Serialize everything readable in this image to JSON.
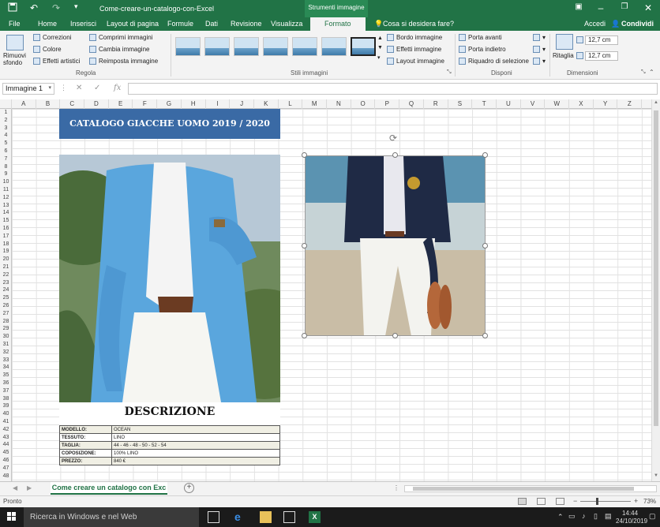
{
  "titlebar": {
    "doc_title": "Come-creare-un-catalogo-con-Excel",
    "context_group": "Strumenti immagine",
    "save_icon": "save-icon",
    "undo_icon": "undo-icon",
    "redo_icon": "redo-icon"
  },
  "tabs": [
    "File",
    "Home",
    "Inserisci",
    "Layout di pagina",
    "Formule",
    "Dati",
    "Revisione",
    "Visualizza",
    "Formato"
  ],
  "active_tab": "Formato",
  "tell_me": "Cosa si desidera fare?",
  "accedi": "Accedi",
  "condividi": "Condividi",
  "ribbon": {
    "rimuovi_sfondo": "Rimuovi sfondo",
    "regola": {
      "label": "Regola",
      "buttons": [
        "Correzioni",
        "Colore",
        "Effetti artistici",
        "Comprimi immagini",
        "Cambia immagine",
        "Reimposta immagine"
      ]
    },
    "stili": {
      "label": "Stili immagini",
      "buttons": [
        "Bordo immagine",
        "Effetti immagine",
        "Layout immagine"
      ]
    },
    "disponi": {
      "label": "Disponi",
      "buttons": [
        "Porta avanti",
        "Porta indietro",
        "Riquadro di selezione"
      ]
    },
    "dimensioni": {
      "label": "Dimensioni",
      "ritaglia": "Ritaglia",
      "height": "12,7 cm",
      "width": "12,7 cm"
    }
  },
  "formula_bar": {
    "name_box": "Immagine 1",
    "fx": "fx",
    "value": ""
  },
  "columns": [
    "A",
    "B",
    "C",
    "D",
    "E",
    "F",
    "G",
    "H",
    "I",
    "J",
    "K",
    "L",
    "M",
    "N",
    "O",
    "P",
    "Q",
    "R",
    "S",
    "T",
    "U",
    "V",
    "W",
    "X",
    "Y",
    "Z"
  ],
  "rows": [
    "1",
    "2",
    "3",
    "4",
    "5",
    "6",
    "7",
    "8",
    "9",
    "10",
    "11",
    "12",
    "13",
    "14",
    "15",
    "16",
    "17",
    "18",
    "19",
    "20",
    "21",
    "22",
    "23",
    "24",
    "25",
    "26",
    "27",
    "28",
    "29",
    "30",
    "31",
    "32",
    "33",
    "34",
    "35",
    "36",
    "37",
    "38",
    "39",
    "40",
    "41",
    "42",
    "43",
    "44",
    "45",
    "46",
    "47",
    "48"
  ],
  "catalog": {
    "header": "CATALOGO GIACCHE UOMO 2019 / 2020",
    "description_title": "DESCRIZIONE",
    "specs": [
      {
        "label": "MODELLO:",
        "value": "OCEAN"
      },
      {
        "label": "TESSUTO:",
        "value": "LINO"
      },
      {
        "label": "TAGLIA:",
        "value": "44 - 46 - 48 - 50 - 52 - 54"
      },
      {
        "label": "COPOSIZIONE:",
        "value": "100% LINO"
      },
      {
        "label": "PREZZO:",
        "value": "840 €"
      }
    ]
  },
  "sheet_tab": "Come creare un catalogo con Exc",
  "status": {
    "text": "Pronto",
    "zoom": "73%"
  },
  "taskbar": {
    "search": "Ricerca in Windows e nel Web",
    "time": "14:44",
    "date": "24/10/2019"
  },
  "colors": {
    "excel_green": "#217346",
    "catalog_header_bg": "#3a6aa5"
  }
}
